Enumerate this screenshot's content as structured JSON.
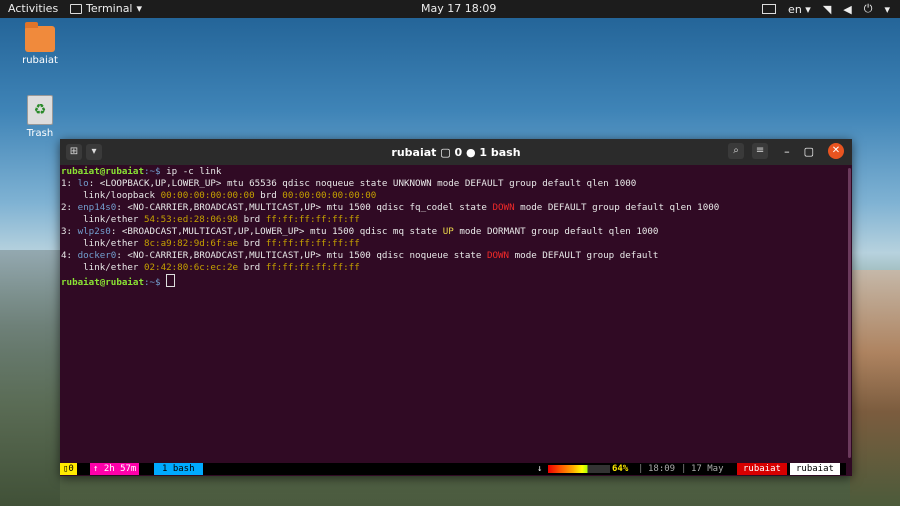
{
  "topbar": {
    "activities": "Activities",
    "app_name": "Terminal",
    "clock": "May 17  18:09",
    "lang": "en"
  },
  "desktop": {
    "home_label": "rubaiat",
    "trash_label": "Trash"
  },
  "window": {
    "title": "rubaiat ▢ 0 ● 1 bash",
    "buttons": {
      "minimize": "–",
      "maximize": "▢",
      "close": "✕"
    }
  },
  "terminal": {
    "prompt_user": "rubaiat@rubaiat",
    "prompt_sep": ":~$",
    "command": " ip -c link",
    "lines": {
      "l1a": "1: ",
      "l1i": "lo",
      "l1b": ": <LOOPBACK,UP,LOWER_UP> mtu 65536 qdisc noqueue state UNKNOWN mode DEFAULT group default qlen 1000",
      "l2a": "    link/loopback ",
      "l2m": "00:00:00:00:00:00",
      "l2b": " brd ",
      "l2n": "00:00:00:00:00:00",
      "l3a": "2: ",
      "l3i": "enp14s0",
      "l3b": ": <NO-CARRIER,BROADCAST,MULTICAST,UP> mtu 1500 qdisc fq_codel state ",
      "l3s": "DOWN",
      "l3c": " mode DEFAULT group default qlen 1000",
      "l4a": "    link/ether ",
      "l4m": "54:53:ed:28:06:98",
      "l4b": " brd ",
      "l4n": "ff:ff:ff:ff:ff:ff",
      "l5a": "3: ",
      "l5i": "wlp2s0",
      "l5b": ": <BROADCAST,MULTICAST,UP,LOWER_UP> mtu 1500 qdisc mq state ",
      "l5s": "UP",
      "l5c": " mode DORMANT group default qlen 1000",
      "l6a": "    link/ether ",
      "l6m": "8c:a9:82:9d:6f:ae",
      "l6b": " brd ",
      "l6n": "ff:ff:ff:ff:ff:ff",
      "l7a": "4: ",
      "l7i": "docker0",
      "l7b": ": <NO-CARRIER,BROADCAST,MULTICAST,UP> mtu 1500 qdisc noqueue state ",
      "l7s": "DOWN",
      "l7c": " mode DEFAULT group default",
      "l8a": "    link/ether ",
      "l8m": "02:42:80:6c:ec:2e",
      "l8b": " brd ",
      "l8n": "ff:ff:ff:ff:ff:ff"
    }
  },
  "statusbar": {
    "session": "0",
    "uptime": "↑ 2h 57m",
    "window": "1 bash",
    "battery_arrow": "↓",
    "battery_pct": "64%",
    "battery_level": 0.64,
    "time": "18:09",
    "date": "17 May",
    "host": "rubaiat",
    "user": "rubaiat",
    "sep": "|"
  },
  "colors": {
    "terminal_bg": "#300a24",
    "prompt": "#8ae234",
    "interface": "#729fcf",
    "mac": "#c4a000",
    "down": "#ef2929",
    "up": "#e9d54a",
    "accent_close": "#e95420"
  }
}
